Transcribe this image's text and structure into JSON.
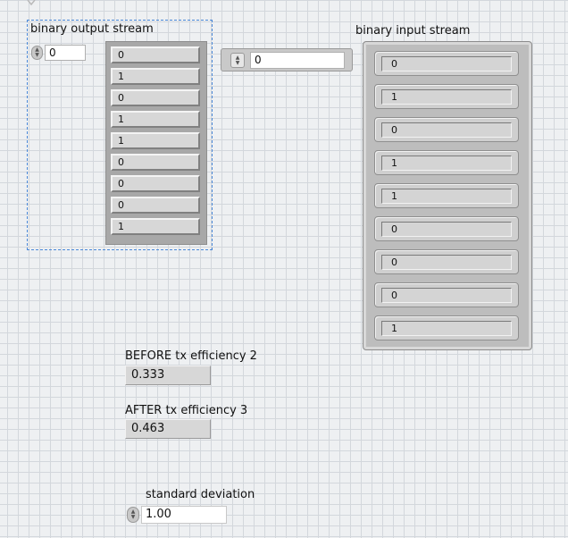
{
  "output_array": {
    "label": "binary output stream",
    "index": "0",
    "values": [
      "0",
      "1",
      "0",
      "1",
      "1",
      "0",
      "0",
      "0",
      "1"
    ]
  },
  "middle_control": {
    "value": "0"
  },
  "input_array": {
    "label": "binary input stream",
    "values": [
      "0",
      "1",
      "0",
      "1",
      "1",
      "0",
      "0",
      "0",
      "1"
    ]
  },
  "before": {
    "label": "BEFORE tx efficiency  2",
    "value": "0.333"
  },
  "after": {
    "label": "AFTER  tx efficiency  3",
    "value": "0.463"
  },
  "std_dev": {
    "label": "standard deviation",
    "value": "1.00"
  }
}
